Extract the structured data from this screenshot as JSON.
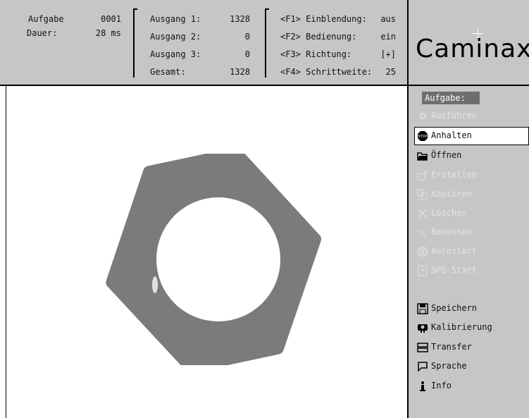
{
  "header": {
    "task_label": "Aufgabe",
    "task_value": "0001",
    "duration_label": "Dauer:",
    "duration_value": "28 ms",
    "outputs": [
      {
        "label": "Ausgang 1:",
        "value": "1328"
      },
      {
        "label": "Ausgang 2:",
        "value": "0"
      },
      {
        "label": "Ausgang 3:",
        "value": "0"
      },
      {
        "label": "Gesamt:",
        "value": "1328"
      }
    ],
    "function_keys": [
      {
        "label": "<F1> Einblendung:",
        "value": "aus"
      },
      {
        "label": "<F2> Bedienung:",
        "value": "ein"
      },
      {
        "label": "<F3> Richtung:",
        "value": "[+]"
      },
      {
        "label": "<F4> Schrittweite:",
        "value": "25"
      }
    ]
  },
  "logo": {
    "text": "Caminax"
  },
  "sidebar": {
    "section_label": "Aufgabe:",
    "items": [
      {
        "label": "Ausführen",
        "icon": "gear-icon",
        "enabled": false
      },
      {
        "label": "Anhalten",
        "icon": "stop-icon",
        "enabled": true,
        "selected": true
      },
      {
        "label": "Öffnen",
        "icon": "folder-open-icon",
        "enabled": true
      },
      {
        "label": "Erstellen",
        "icon": "create-icon",
        "enabled": false
      },
      {
        "label": "Kopieren",
        "icon": "copy-icon",
        "enabled": false
      },
      {
        "label": "Löschen",
        "icon": "delete-icon",
        "enabled": false
      },
      {
        "label": "Benennen",
        "icon": "rename-icon",
        "enabled": false
      },
      {
        "label": "Autostart",
        "icon": "autostart-icon",
        "enabled": false
      },
      {
        "label": "SPS-Start",
        "icon": "plc-start-icon",
        "enabled": false
      }
    ],
    "bottom_items": [
      {
        "label": "Speichern",
        "icon": "save-icon"
      },
      {
        "label": "Kalibrierung",
        "icon": "calibration-icon"
      },
      {
        "label": "Transfer",
        "icon": "transfer-icon"
      },
      {
        "label": "Sprache",
        "icon": "speech-bubble-icon"
      },
      {
        "label": "Info",
        "icon": "info-icon"
      }
    ]
  },
  "colors": {
    "panel": "#c6c6c6",
    "disabled_text": "#e4e4e4",
    "nut": "#7b7b7b",
    "selected_label_bg": "#6e6e6e"
  }
}
